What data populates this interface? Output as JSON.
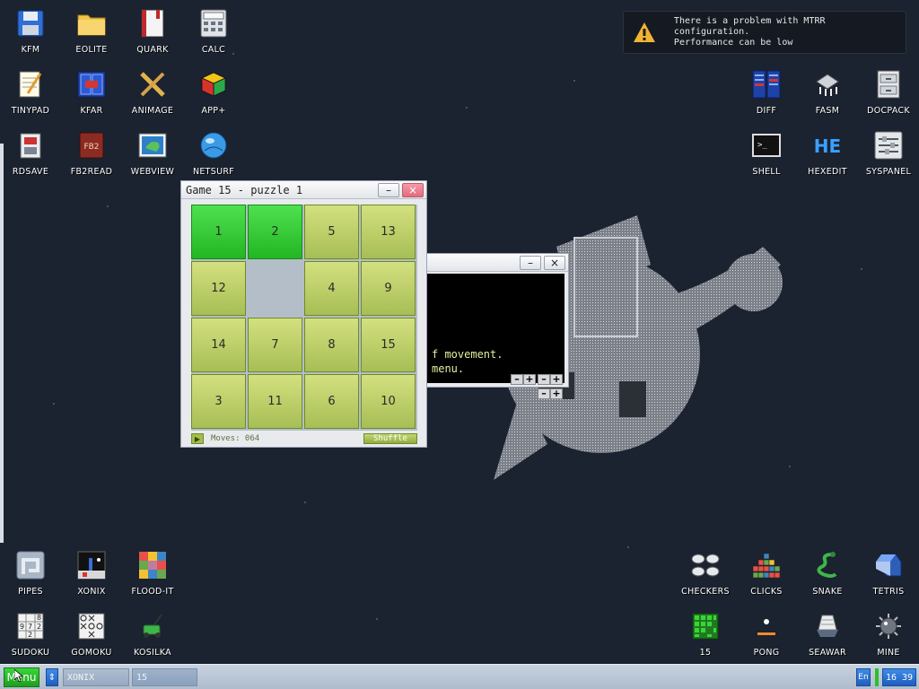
{
  "notification": {
    "line1": "There is a problem with MTRR configuration.",
    "line2": "Performance can be low"
  },
  "desktop": {
    "top_left": [
      "KFM",
      "EOLITE",
      "QUARK",
      "CALC",
      "TINYPAD",
      "KFAR",
      "ANIMAGE",
      "APP+",
      "RDSAVE",
      "FB2READ",
      "WEBVIEW",
      "NETSURF"
    ],
    "top_right": [
      "DIFF",
      "FASM",
      "DOCPACK",
      "SHELL",
      "HEXEDIT",
      "SYSPANEL"
    ],
    "bottom_left": [
      "PIPES",
      "XONIX",
      "FLOOD-IT",
      "SUDOKU",
      "GOMOKU",
      "KOSILKA"
    ],
    "bottom_right": [
      "CHECKERS",
      "CLICKS",
      "SNAKE",
      "TETRIS",
      "15",
      "PONG",
      "SEAWAR",
      "MINE"
    ]
  },
  "terminal_window": {
    "line1": "f movement.",
    "line2": "menu."
  },
  "game_window": {
    "title": "Game 15 - puzzle 1",
    "tiles": [
      "1",
      "2",
      "5",
      "13",
      "12",
      "",
      "4",
      "9",
      "14",
      "7",
      "8",
      "15",
      "3",
      "11",
      "6",
      "10"
    ],
    "moves_label": "Moves: 064",
    "shuffle_label": "Shuffle"
  },
  "taskbar": {
    "menu_label": "Menu",
    "tasks": [
      "XONIX",
      "15"
    ],
    "language": "En",
    "clock": "16 39"
  },
  "colors": {
    "desktop_bg": "#1b2230",
    "tile_correct": "#2fc92f",
    "tile_default": "#bfd06a",
    "taskbar": "#b8c4d4"
  }
}
